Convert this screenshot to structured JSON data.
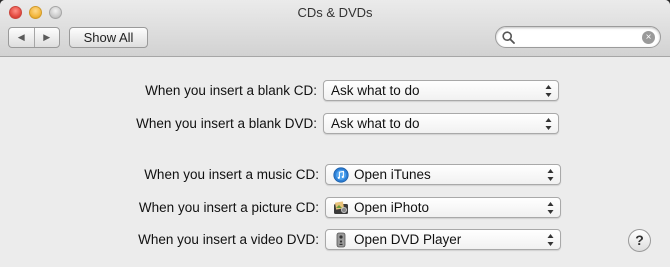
{
  "window": {
    "title": "CDs & DVDs"
  },
  "toolbar": {
    "back_icon": "back-arrow-icon",
    "forward_icon": "forward-arrow-icon",
    "show_all_label": "Show All",
    "search": {
      "value": "",
      "placeholder": ""
    }
  },
  "settings": [
    {
      "label": "When you insert a blank CD:",
      "value": "Ask what to do",
      "icon": null
    },
    {
      "label": "When you insert a blank DVD:",
      "value": "Ask what to do",
      "icon": null
    },
    {
      "label": "When you insert a music CD:",
      "value": "Open iTunes",
      "icon": "itunes-icon"
    },
    {
      "label": "When you insert a picture CD:",
      "value": "Open iPhoto",
      "icon": "iphoto-icon"
    },
    {
      "label": "When you insert a video DVD:",
      "value": "Open DVD Player",
      "icon": "dvd-player-icon"
    }
  ],
  "help": {
    "label": "?"
  }
}
